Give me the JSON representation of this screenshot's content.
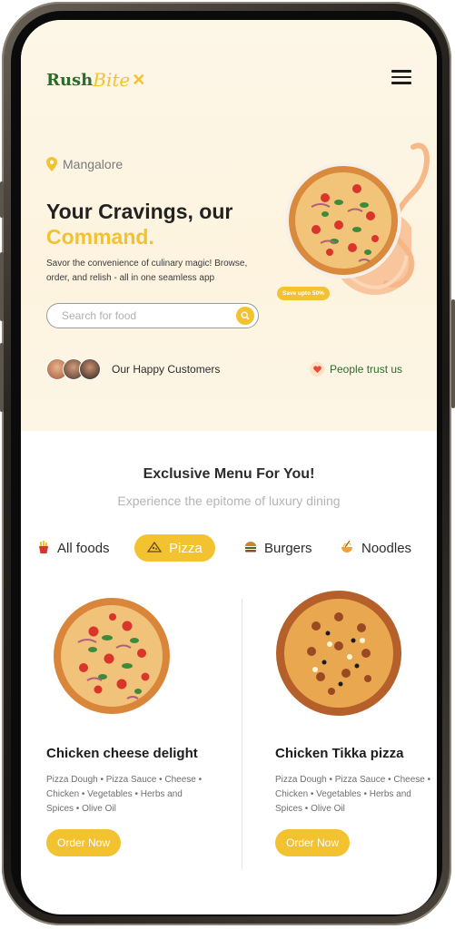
{
  "app": {
    "logo_part1": "Rush",
    "logo_part2": "Bite"
  },
  "hero": {
    "location": "Mangalore",
    "headline_line1": "Your Cravings, our",
    "headline_line2": "Command.",
    "description": "Savor the convenience of culinary magic! Browse, order, and relish - all in one seamless app",
    "search_placeholder": "Search for food",
    "happy_customers": "Our Happy Customers",
    "trust": "People trust us",
    "badge": "Save upto 50%"
  },
  "menu": {
    "title": "Exclusive Menu For You!",
    "subtitle": "Experience the epitome of luxury dining",
    "tabs": [
      {
        "label": "All foods",
        "icon": "fries-icon"
      },
      {
        "label": "Pizza",
        "icon": "pizza-icon",
        "active": true
      },
      {
        "label": "Burgers",
        "icon": "burger-icon"
      },
      {
        "label": "Noodles",
        "icon": "noodles-icon"
      }
    ],
    "items": [
      {
        "name": "Chicken cheese delight",
        "ingredients": "Pizza Dough • Pizza Sauce • Cheese • Chicken • Vegetables • Herbs and Spices • Olive Oil",
        "button": "Order Now"
      },
      {
        "name": "Chicken Tikka pizza",
        "ingredients": "Pizza Dough • Pizza Sauce • Cheese • Chicken • Vegetables • Herbs and Spices • Olive Oil",
        "button": "Order Now"
      }
    ]
  },
  "colors": {
    "accent": "#f2c230",
    "brand_green": "#2e6b2a",
    "hero_bg": "#fdf5e2"
  }
}
